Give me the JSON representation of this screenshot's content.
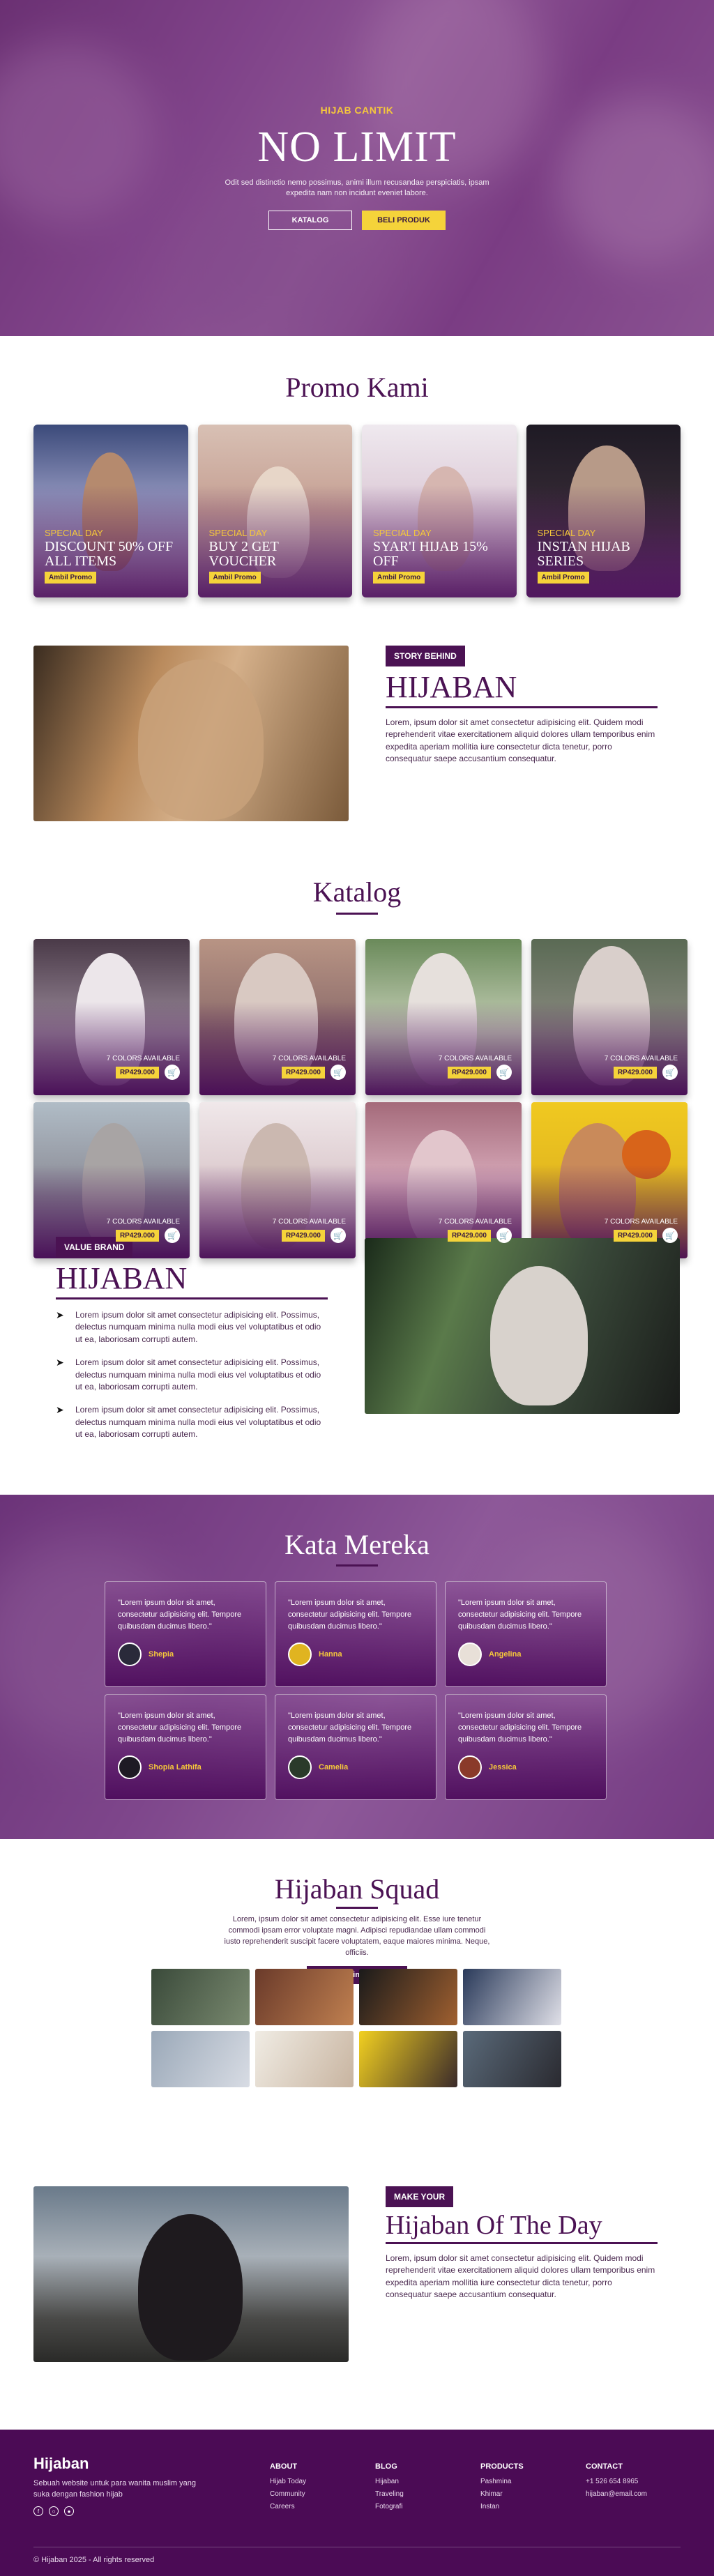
{
  "hero": {
    "kicker": "HIJAB CANTIK",
    "title": "NO LIMIT",
    "description": "Odit sed distinctio nemo possimus, animi illum recusandae perspiciatis, ipsam expedita nam non incidunt eveniet labore.",
    "btn_catalog": "KATALOG",
    "btn_buy": "BELI PRODUK"
  },
  "promo": {
    "title": "Promo Kami",
    "cards": [
      {
        "kicker": "SPECIAL DAY",
        "name": "DISCOUNT 50% OFF ALL ITEMS",
        "button": "Ambil Promo"
      },
      {
        "kicker": "SPECIAL DAY",
        "name": "BUY 2 GET VOUCHER",
        "button": "Ambil Promo"
      },
      {
        "kicker": "SPECIAL DAY",
        "name": "SYAR'I HIJAB 15% OFF",
        "button": "Ambil Promo"
      },
      {
        "kicker": "SPECIAL DAY",
        "name": "INSTAN HIJAB SERIES",
        "button": "Ambil Promo"
      }
    ]
  },
  "story": {
    "tag": "STORY BEHIND",
    "brand": "HIJABAN",
    "text": "Lorem, ipsum dolor sit amet consectetur adipisicing elit. Quidem modi reprehenderit vitae exercitationem aliquid dolores ullam temporibus enim expedita aperiam mollitia iure consectetur dicta tenetur, porro consequatur saepe accusantium consequatur."
  },
  "katalog": {
    "title": "Katalog",
    "items": [
      {
        "colors": "7 COLORS AVAILABLE",
        "price": "RP429.000"
      },
      {
        "colors": "7 COLORS AVAILABLE",
        "price": "RP429.000"
      },
      {
        "colors": "7 COLORS AVAILABLE",
        "price": "RP429.000"
      },
      {
        "colors": "7 COLORS AVAILABLE",
        "price": "RP429.000"
      },
      {
        "colors": "7 COLORS AVAILABLE",
        "price": "RP429.000"
      },
      {
        "colors": "7 COLORS AVAILABLE",
        "price": "RP429.000"
      },
      {
        "colors": "7 COLORS AVAILABLE",
        "price": "RP429.000"
      },
      {
        "colors": "7 COLORS AVAILABLE",
        "price": "RP429.000"
      }
    ]
  },
  "value": {
    "tag": "VALUE BRAND",
    "brand": "HIJABAN",
    "points": [
      "Lorem ipsum dolor sit amet consectetur adipisicing elit. Possimus, delectus numquam minima nulla modi eius vel voluptatibus et odio ut ea, laboriosam corrupti autem.",
      "Lorem ipsum dolor sit amet consectetur adipisicing elit. Possimus, delectus numquam minima nulla modi eius vel voluptatibus et odio ut ea, laboriosam corrupti autem.",
      "Lorem ipsum dolor sit amet consectetur adipisicing elit. Possimus, delectus numquam minima nulla modi eius vel voluptatibus et odio ut ea, laboriosam corrupti autem."
    ]
  },
  "testimoni": {
    "title": "Kata Mereka",
    "items": [
      {
        "quote": "\"Lorem ipsum dolor sit amet, consectetur adipisicing elit. Tempore quibusdam ducimus libero.\"",
        "name": "Shepia"
      },
      {
        "quote": "\"Lorem ipsum dolor sit amet, consectetur adipisicing elit. Tempore quibusdam ducimus libero.\"",
        "name": "Hanna"
      },
      {
        "quote": "\"Lorem ipsum dolor sit amet, consectetur adipisicing elit. Tempore quibusdam ducimus libero.\"",
        "name": "Angelina"
      },
      {
        "quote": "\"Lorem ipsum dolor sit amet, consectetur adipisicing elit. Tempore quibusdam ducimus libero.\"",
        "name": "Shopia Lathifa"
      },
      {
        "quote": "\"Lorem ipsum dolor sit amet, consectetur adipisicing elit. Tempore quibusdam ducimus libero.\"",
        "name": "Camelia"
      },
      {
        "quote": "\"Lorem ipsum dolor sit amet, consectetur adipisicing elit. Tempore quibusdam ducimus libero.\"",
        "name": "Jessica"
      }
    ]
  },
  "squad": {
    "title": "Hijaban Squad",
    "description": "Lorem, ipsum dolor sit amet consectetur adipisicing elit. Esse iure tenetur commodi ipsam error voluptate magni. Adipisci repudiandae ullam commodi iusto reprehenderit suscipit facere voluptatem, eaque maiores minima. Neque, officiis.",
    "button": "Follow us in Instagram"
  },
  "day": {
    "tag": "MAKE YOUR",
    "title": "Hijaban Of The Day",
    "text": "Lorem, ipsum dolor sit amet consectetur adipisicing elit. Quidem modi reprehenderit vitae exercitationem aliquid dolores ullam temporibus enim expedita aperiam mollitia iure consectetur dicta tenetur, porro consequatur saepe accusantium consequatur."
  },
  "footer": {
    "brand": "Hijaban",
    "description": "Sebuah website untuk para wanita muslim yang suka dengan fashion hijab",
    "columns": [
      {
        "heading": "ABOUT",
        "links": [
          "Hijab Today",
          "Community",
          "Careers"
        ]
      },
      {
        "heading": "BLOG",
        "links": [
          "Hijaban",
          "Traveling",
          "Fotografi"
        ]
      },
      {
        "heading": "PRODUCTS",
        "links": [
          "Pashmina",
          "Khimar",
          "Instan"
        ]
      },
      {
        "heading": "CONTACT",
        "links": [
          "+1 526 654 8965",
          "hijaban@email.com"
        ]
      }
    ],
    "copyright": "© Hijaban 2025 - All rights reserved"
  },
  "colors": {
    "primary": "#4b1253",
    "accent": "#f5d33a",
    "footer": "#4b0b55"
  }
}
